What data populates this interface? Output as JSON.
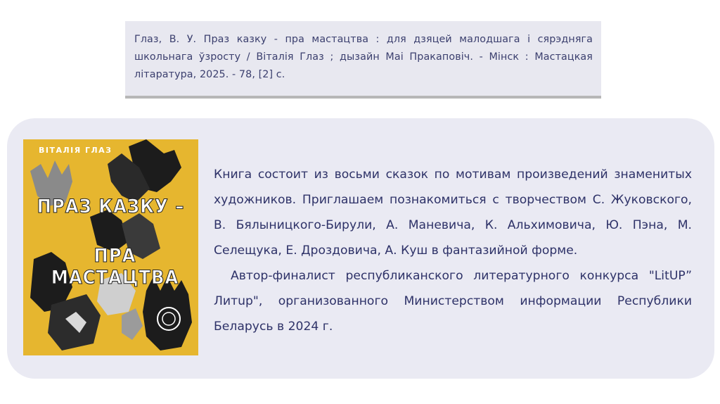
{
  "citation": {
    "text": "Глаз, В. У. Праз казку - пра мастацтва : для дзяцей малодшага і сярэдняга школьнага ўзросту / Віталія Глаз ; дызайн Маі Пракаповіч. - Мінск : Мастацкая літаратура, 2025. - 78, [2] с."
  },
  "cover": {
    "author": "ВІТАЛІЯ ГЛАЗ",
    "title_line1": "ПРАЗ КАЗКУ –",
    "title_line2": "ПРА МАСТАЦТВА",
    "colors": {
      "background": "#e6b62f",
      "ink": "#1c1c1c"
    }
  },
  "description": {
    "paragraph1": "Книга состоит из восьми сказок по мотивам произведений знаменитых художников. Приглашаем познакомиться с творчеством С. Жуковского, В. Бялыницкого-Бирули, А. Маневича, К. Альхимовича, Ю. Пэна, М. Селещука, Е. Дроздовича, А. Куш в фантазийной форме.",
    "paragraph2": "Автор-финалист республиканского литературного конкурса \"LitUP” Литup\", организованного Министерством информации Республики Беларусь в 2024 г."
  },
  "colors": {
    "text": "#2e3268",
    "card_background": "#eaeaf3",
    "citation_background": "#e8e8f0"
  }
}
